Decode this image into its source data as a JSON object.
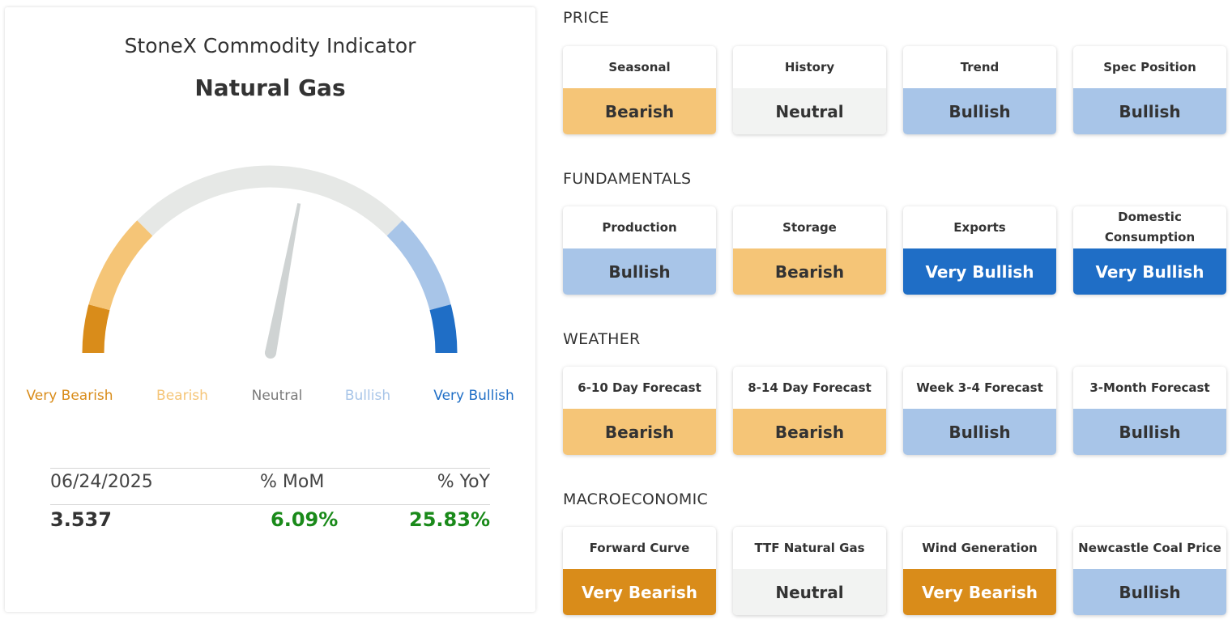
{
  "indicator": {
    "title": "StoneX Commodity Indicator",
    "commodity": "Natural Gas",
    "gauge": {
      "reading": 0.56,
      "labels": [
        {
          "text": "Very Bearish",
          "color": "#d98c1a"
        },
        {
          "text": "Bearish",
          "color": "#f5c577"
        },
        {
          "text": "Neutral",
          "color": "#7a7a7a"
        },
        {
          "text": "Bullish",
          "color": "#a8c5e8"
        },
        {
          "text": "Very Bullish",
          "color": "#1f6ec6"
        }
      ]
    },
    "stats": {
      "date": "06/24/2025",
      "mom_label": "% MoM",
      "yoy_label": "% YoY",
      "price": "3.537",
      "mom": "6.09%",
      "yoy": "25.83%",
      "positive_color": "#1a8a1a"
    }
  },
  "sections": [
    {
      "title": "PRICE",
      "cards": [
        {
          "label": "Seasonal",
          "value": "Bearish"
        },
        {
          "label": "History",
          "value": "Neutral"
        },
        {
          "label": "Trend",
          "value": "Bullish"
        },
        {
          "label": "Spec Position",
          "value": "Bullish"
        }
      ]
    },
    {
      "title": "FUNDAMENTALS",
      "cards": [
        {
          "label": "Production",
          "value": "Bullish"
        },
        {
          "label": "Storage",
          "value": "Bearish"
        },
        {
          "label": "Exports",
          "value": "Very Bullish"
        },
        {
          "label": "Domestic Consumption",
          "value": "Very Bullish"
        }
      ]
    },
    {
      "title": "WEATHER",
      "cards": [
        {
          "label": "6-10 Day Forecast",
          "value": "Bearish"
        },
        {
          "label": "8-14 Day Forecast",
          "value": "Bearish"
        },
        {
          "label": "Week 3-4 Forecast",
          "value": "Bullish"
        },
        {
          "label": "3-Month Forecast",
          "value": "Bullish"
        }
      ]
    },
    {
      "title": "MACROECONOMIC",
      "cards": [
        {
          "label": "Forward Curve",
          "value": "Very Bearish"
        },
        {
          "label": "TTF Natural Gas",
          "value": "Neutral"
        },
        {
          "label": "Wind Generation",
          "value": "Very Bearish"
        },
        {
          "label": "Newcastle Coal Price",
          "value": "Bullish"
        }
      ]
    }
  ],
  "colors": {
    "very_bearish": "#d98c1a",
    "bearish": "#f5c577",
    "neutral": "#e6e8e6",
    "bullish": "#a8c5e8",
    "very_bullish": "#1f6ec6",
    "needle": "#cfd3d3"
  }
}
